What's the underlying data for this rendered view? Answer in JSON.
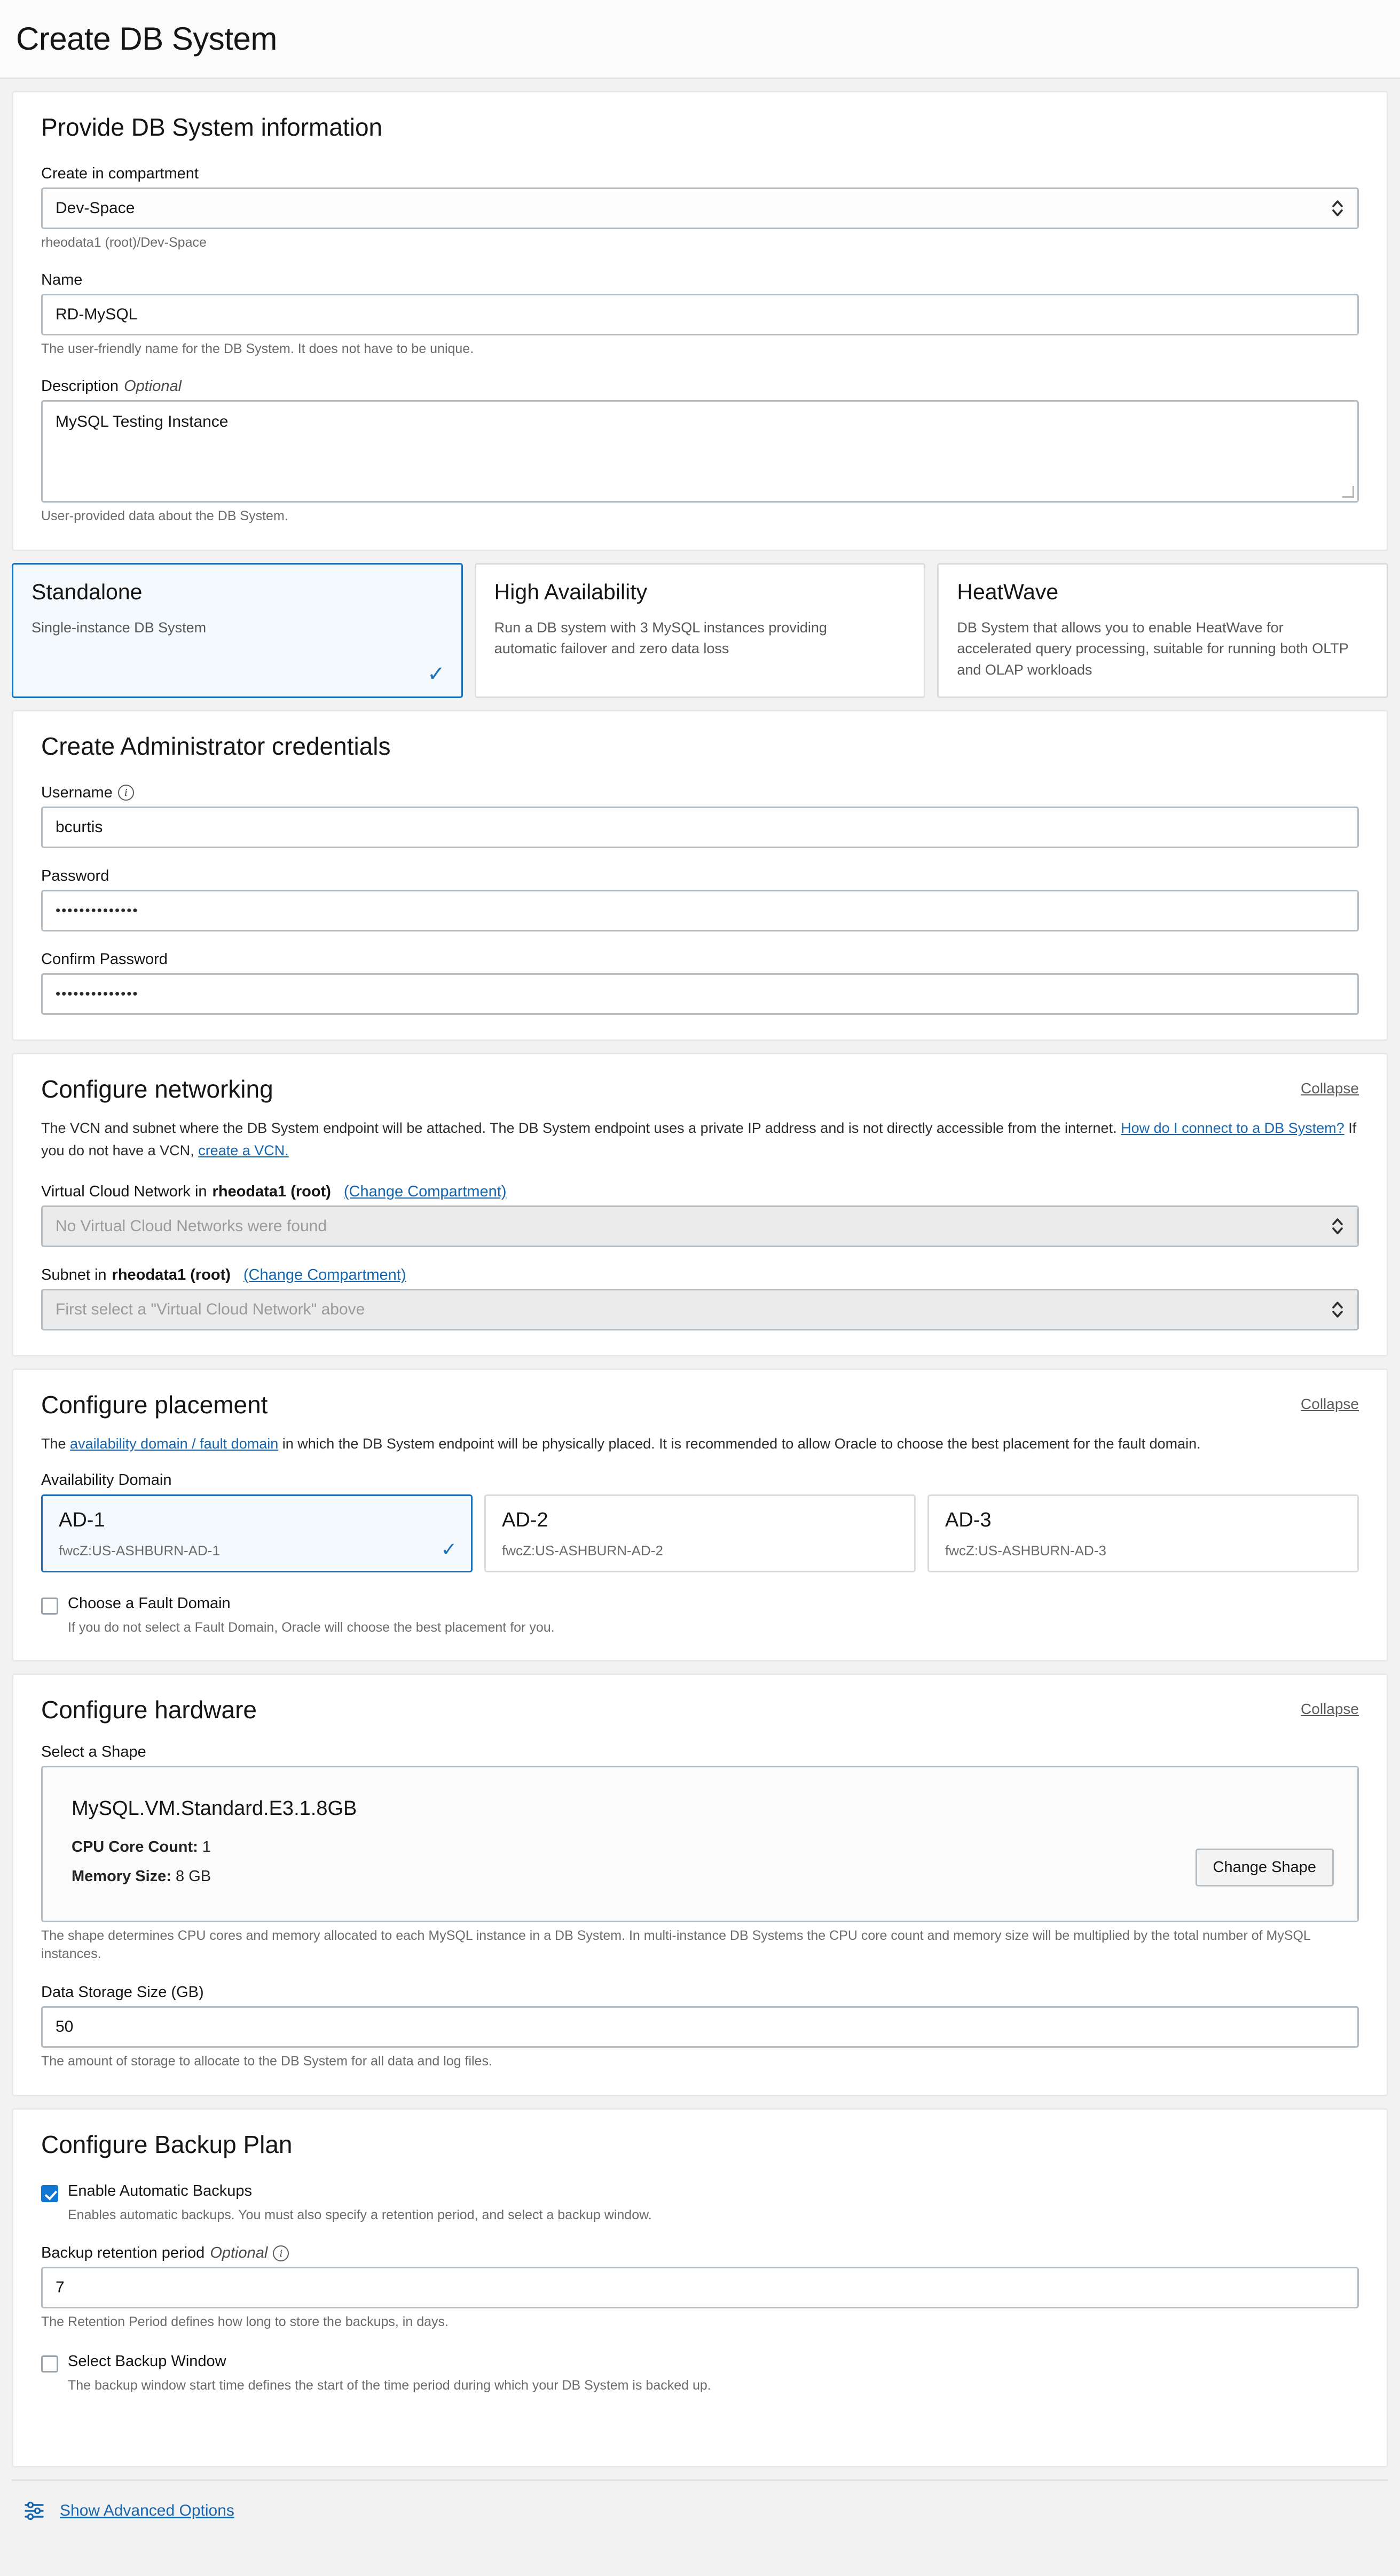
{
  "header": {
    "title": "Create DB System"
  },
  "info_section": {
    "heading": "Provide DB System information",
    "compartment_label": "Create in compartment",
    "compartment_value": "Dev-Space",
    "compartment_help": "rheodata1 (root)/Dev-Space",
    "name_label": "Name",
    "name_value": "RD-MySQL",
    "name_help": "The user-friendly name for the DB System. It does not have to be unique.",
    "description_label": "Description",
    "description_optional": "Optional",
    "description_value": "MySQL Testing Instance",
    "description_help": "User-provided data about the DB System."
  },
  "system_types": [
    {
      "title": "Standalone",
      "description": "Single-instance DB System",
      "selected": true,
      "check": "✓"
    },
    {
      "title": "High Availability",
      "description": "Run a DB system with 3 MySQL instances providing automatic failover and zero data loss",
      "selected": false,
      "check": ""
    },
    {
      "title": "HeatWave",
      "description": "DB System that allows you to enable HeatWave for accelerated query processing, suitable for running both OLTP and OLAP workloads",
      "selected": false,
      "check": ""
    }
  ],
  "credentials": {
    "heading": "Create Administrator credentials",
    "username_label": "Username",
    "username_info_icon": "info-icon",
    "username_value": "bcurtis",
    "password_label": "Password",
    "password_value": "••••••••••••••",
    "confirm_label": "Confirm Password",
    "confirm_value": "••••••••••••••"
  },
  "networking": {
    "heading": "Configure networking",
    "collapse": "Collapse",
    "desc_part1": "The VCN and subnet where the DB System endpoint will be attached. The DB System endpoint uses a private IP address and is not directly accessible from the internet. ",
    "link1": "How do I connect to a DB System?",
    "desc_part2": " If you do not have a VCN, ",
    "link2": "create a VCN.",
    "vcn_label_prefix": "Virtual Cloud Network in ",
    "vcn_label_bold": "rheodata1 (root)",
    "change_compartment": "(Change Compartment)",
    "vcn_placeholder": "No Virtual Cloud Networks were found",
    "subnet_label_prefix": "Subnet in ",
    "subnet_label_bold": "rheodata1 (root)",
    "subnet_placeholder": "First select a \"Virtual Cloud Network\" above"
  },
  "placement": {
    "heading": "Configure placement",
    "collapse": "Collapse",
    "desc_pre": "The ",
    "desc_link": "availability domain / fault domain",
    "desc_post": " in which the DB System endpoint will be physically placed. It is recommended to allow Oracle to choose the best placement for the fault domain.",
    "ad_label": "Availability Domain",
    "domains": [
      {
        "title": "AD-1",
        "sub": "fwcZ:US-ASHBURN-AD-1",
        "selected": true,
        "check": "✓"
      },
      {
        "title": "AD-2",
        "sub": "fwcZ:US-ASHBURN-AD-2",
        "selected": false,
        "check": ""
      },
      {
        "title": "AD-3",
        "sub": "fwcZ:US-ASHBURN-AD-3",
        "selected": false,
        "check": ""
      }
    ],
    "fault_checkbox_label": "Choose a Fault Domain",
    "fault_checkbox_checked": false,
    "fault_help": "If you do not select a Fault Domain, Oracle will choose the best placement for you."
  },
  "hardware": {
    "heading": "Configure hardware",
    "collapse": "Collapse",
    "select_shape_label": "Select a Shape",
    "shape_name": "MySQL.VM.Standard.E3.1.8GB",
    "cpu_label": "CPU Core Count:",
    "cpu_value": "1",
    "memory_label": "Memory Size:",
    "memory_value": "8 GB",
    "change_shape_button": "Change Shape",
    "shape_help": "The shape determines CPU cores and memory allocated to each MySQL instance in a DB System. In multi-instance DB Systems the CPU core count and memory size will be multiplied by the total number of MySQL instances.",
    "storage_label": "Data Storage Size (GB)",
    "storage_value": "50",
    "storage_help": "The amount of storage to allocate to the DB System for all data and log files."
  },
  "backup": {
    "heading": "Configure Backup Plan",
    "enable_label": "Enable Automatic Backups",
    "enable_checked": true,
    "enable_help": "Enables automatic backups. You must also specify a retention period, and select a backup window.",
    "retention_label": "Backup retention period",
    "retention_optional": "Optional",
    "retention_info_icon": "info-icon",
    "retention_value": "7",
    "retention_help": "The Retention Period defines how long to store the backups, in days.",
    "window_label": "Select Backup Window",
    "window_checked": false,
    "window_help": "The backup window start time defines the start of the time period during which your DB System is backed up."
  },
  "footer": {
    "advanced_icon": "sliders-icon",
    "advanced_label": "Show Advanced Options"
  },
  "colors": {
    "accent_blue": "#1b70b8",
    "link_blue": "#1765ad",
    "checkbox_blue": "#1175d2",
    "selected_card_bg": "#f4f9fd"
  }
}
